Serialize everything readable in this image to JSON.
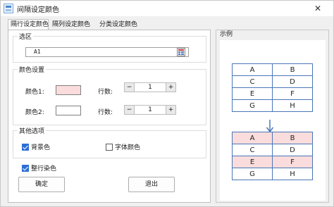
{
  "window": {
    "title": "间隔设定颜色",
    "close_glyph": "✕"
  },
  "tabs": [
    {
      "label": "隔行设定颜色"
    },
    {
      "label": "隔列设定颜色"
    },
    {
      "label": "分类设定颜色"
    }
  ],
  "range": {
    "group_title": "选区",
    "value": "A1"
  },
  "color_settings": {
    "group_title": "颜色设置",
    "color1_label": "颜色1:",
    "color1_value": "#fadcdc",
    "color2_label": "颜色2:",
    "color2_value": "#ffffff",
    "rows_label_1": "行数:",
    "rows_value_1": "1",
    "rows_label_2": "行数:",
    "rows_value_2": "1",
    "minus_glyph": "−",
    "plus_glyph": "+"
  },
  "other_options": {
    "group_title": "其他选项",
    "background_label": "背景色",
    "background_checked": true,
    "font_color_label": "字体颜色",
    "font_color_checked": false
  },
  "whole_row": {
    "label": "整行染色",
    "checked": true
  },
  "buttons": {
    "ok_label": "确定",
    "exit_label": "退出"
  },
  "example": {
    "title": "示例",
    "before_rows": [
      [
        "A",
        "B"
      ],
      [
        "C",
        "D"
      ],
      [
        "E",
        "F"
      ],
      [
        "G",
        "H"
      ]
    ],
    "after_rows": [
      [
        "A",
        "B"
      ],
      [
        "C",
        "D"
      ],
      [
        "E",
        "F"
      ],
      [
        "G",
        "H"
      ]
    ],
    "highlight_color": "#fadcdc",
    "border_color": "#4a76b8"
  }
}
